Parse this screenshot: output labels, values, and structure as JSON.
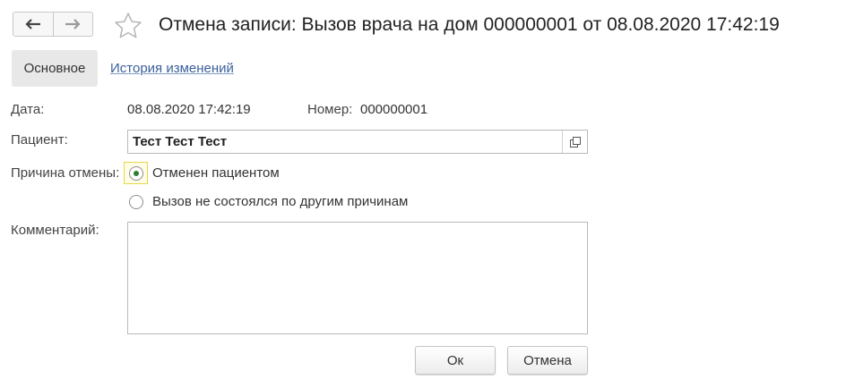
{
  "window": {
    "title": "Отмена записи: Вызов врача на дом 000000001 от 08.08.2020 17:42:19"
  },
  "tabs": [
    {
      "label": "Основное"
    },
    {
      "label": "История изменений"
    }
  ],
  "form": {
    "date_label": "Дата:",
    "date_value": "08.08.2020 17:42:19",
    "number_label": "Номер:",
    "number_value": "000000001",
    "patient_label": "Пациент:",
    "patient_value": "Тест Тест Тест",
    "reason_label": "Причина отмены:",
    "reason_options": [
      {
        "label": "Отменен пациентом",
        "selected": true
      },
      {
        "label": "Вызов не состоялся по другим причинам",
        "selected": false
      }
    ],
    "comment_label": "Комментарий:",
    "comment_value": ""
  },
  "buttons": {
    "ok_label": "Ок",
    "cancel_label": "Отмена"
  },
  "colors": {
    "link": "#3a5f9b",
    "radio_selected": "#2e7d32",
    "focus_border": "#e6d84a"
  },
  "icons": {
    "back": "arrow-left-icon",
    "forward": "arrow-right-icon",
    "favorite": "star-icon",
    "open": "open-window-icon"
  }
}
